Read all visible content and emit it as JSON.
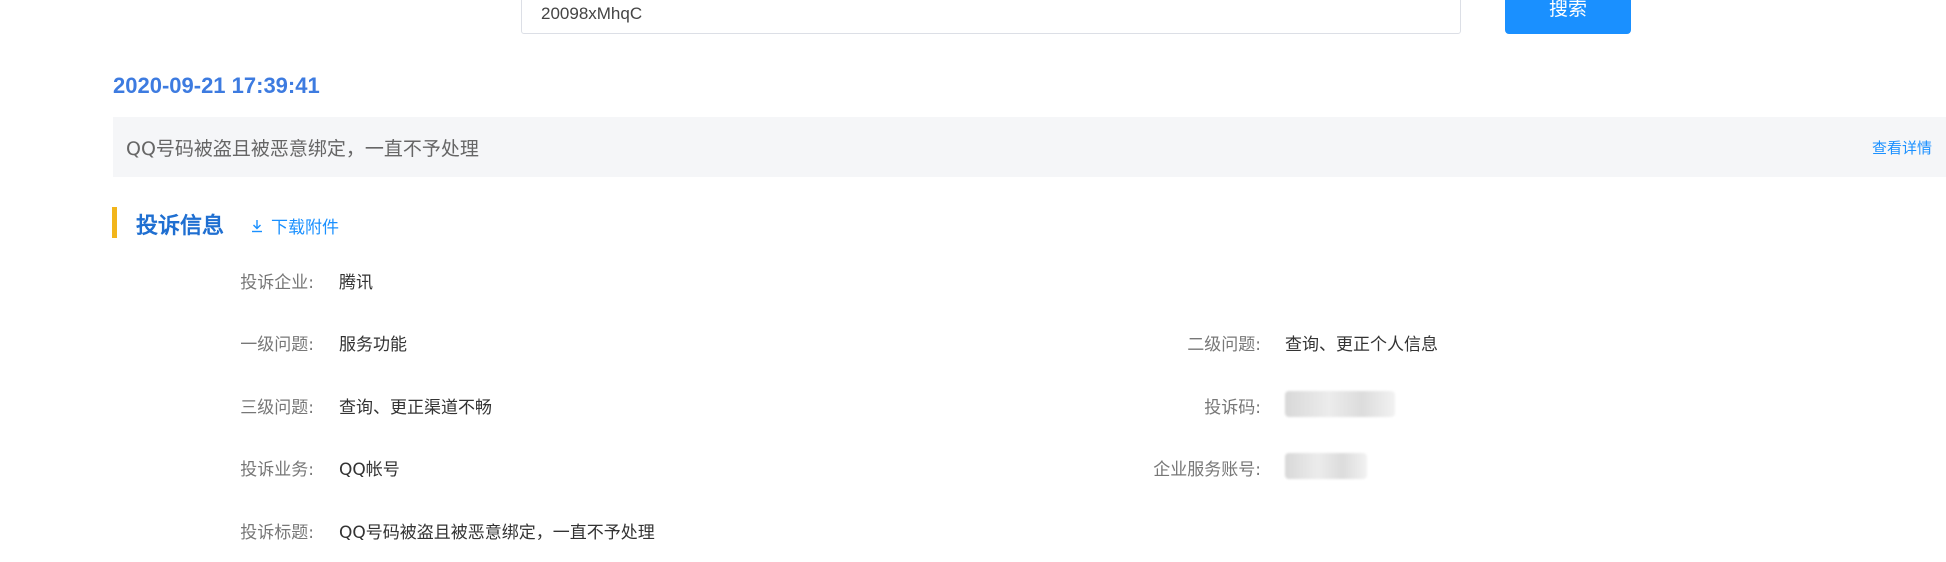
{
  "search": {
    "input_value": "20098xMhqC",
    "button_label": "搜索"
  },
  "complaint": {
    "date": "2020-09-21 17:39:41",
    "summary": "QQ号码被盗且被恶意绑定，一直不予处理",
    "view_details": "查看详情"
  },
  "section": {
    "title": "投诉信息",
    "download_label": "下载附件",
    "download_icon": "download-icon",
    "accent_color": "#f2b51b"
  },
  "fields": {
    "company": {
      "label": "投诉企业:",
      "value": "腾讯"
    },
    "level1": {
      "label": "一级问题:",
      "value": "服务功能"
    },
    "level2": {
      "label": "二级问题:",
      "value": "查询、更正个人信息"
    },
    "level3": {
      "label": "三级问题:",
      "value": "查询、更正渠道不畅"
    },
    "code": {
      "label": "投诉码:",
      "value": ""
    },
    "business": {
      "label": "投诉业务:",
      "value": "QQ帐号"
    },
    "service_account": {
      "label": "企业服务账号:",
      "value": ""
    },
    "complaint_title": {
      "label": "投诉标题:",
      "value": "QQ号码被盗且被恶意绑定，一直不予处理"
    }
  },
  "colors": {
    "primary": "#1a90ff",
    "date_blue": "#3d7be0",
    "section_title": "#1f6fd1",
    "summary_bg": "#f5f6f8"
  }
}
